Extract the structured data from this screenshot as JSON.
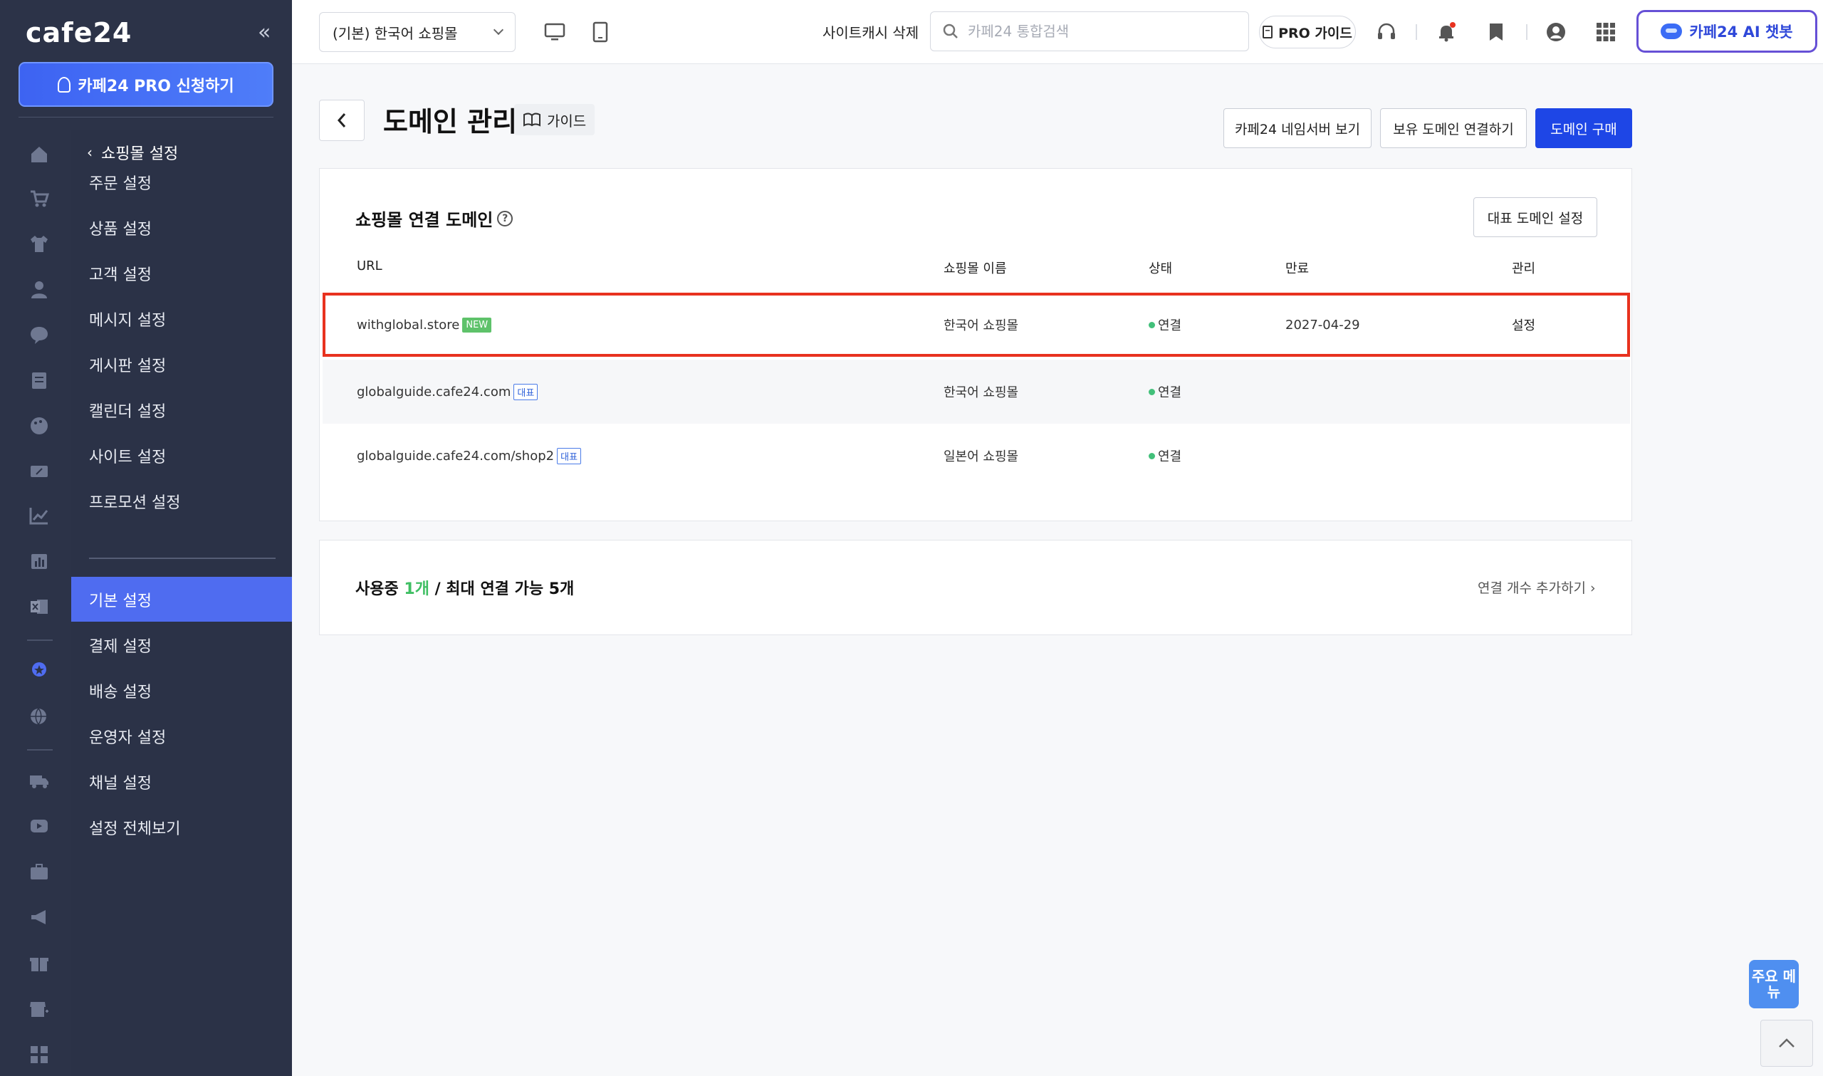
{
  "sidebar": {
    "logo": "cafe24",
    "pro_button": "카페24 PRO 신청하기",
    "back_label": "쇼핑몰 설정",
    "menu_top": [
      "주문 설정",
      "상품 설정",
      "고객 설정",
      "메시지 설정",
      "게시판 설정",
      "캘린더 설정",
      "사이트 설정",
      "프로모션 설정"
    ],
    "menu_bottom": [
      "기본 설정",
      "결제 설정",
      "배송 설정",
      "운영자 설정",
      "채널 설정",
      "설정 전체보기"
    ],
    "active_item": "기본 설정",
    "rail_icons": [
      "home-icon",
      "cart-icon",
      "shirt-icon",
      "user-icon",
      "chat-icon",
      "board-icon",
      "palette-icon",
      "coupon-icon",
      "stats-icon",
      "bar-chart-icon",
      "excel-icon",
      "medal-icon",
      "global-icon",
      "truck-icon",
      "video-icon",
      "briefcase-icon",
      "megaphone-icon",
      "gift-icon",
      "store-icon",
      "grid-icon"
    ]
  },
  "topbar": {
    "shop_select": "(기본) 한국어 쇼핑몰",
    "cache_delete": "사이트캐시 삭제",
    "search_placeholder": "카페24 통합검색",
    "pro_guide": "PRO 가이드",
    "ai_chatbot": "카페24 AI 챗봇"
  },
  "page": {
    "title": "도메인 관리",
    "guide": "가이드",
    "btn_nameserver": "카페24 네임서버 보기",
    "btn_connect": "보유 도메인 연결하기",
    "btn_buy": "도메인 구매"
  },
  "domains": {
    "section_title": "쇼핑몰 연결 도메인",
    "rep_button": "대표 도메인 설정",
    "headers": {
      "url": "URL",
      "shop": "쇼핑몰 이름",
      "status": "상태",
      "expire": "만료",
      "manage": "관리"
    },
    "rows": [
      {
        "url": "withglobal.store",
        "badge": "NEW",
        "shop": "한국어 쇼핑몰",
        "status": "연결",
        "expire": "2027-04-29",
        "manage": "설정"
      },
      {
        "url": "globalguide.cafe24.com",
        "badge": "대표",
        "shop": "한국어 쇼핑몰",
        "status": "연결",
        "expire": "",
        "manage": ""
      },
      {
        "url": "globalguide.cafe24.com/shop2",
        "badge": "대표",
        "shop": "일본어 쇼핑몰",
        "status": "연결",
        "expire": "",
        "manage": ""
      }
    ]
  },
  "usage": {
    "prefix": "사용중 ",
    "used": "1개",
    "suffix": " / 최대 연결 가능 5개",
    "add_link": "연결 개수 추가하기"
  },
  "floating": {
    "menu": "주요 메뉴"
  },
  "colors": {
    "sidebar_bg": "#2c3348",
    "accent": "#1e46e6",
    "active_menu": "#4f6cf0",
    "highlight_border": "#e8321f",
    "status_green": "#42c07a"
  }
}
